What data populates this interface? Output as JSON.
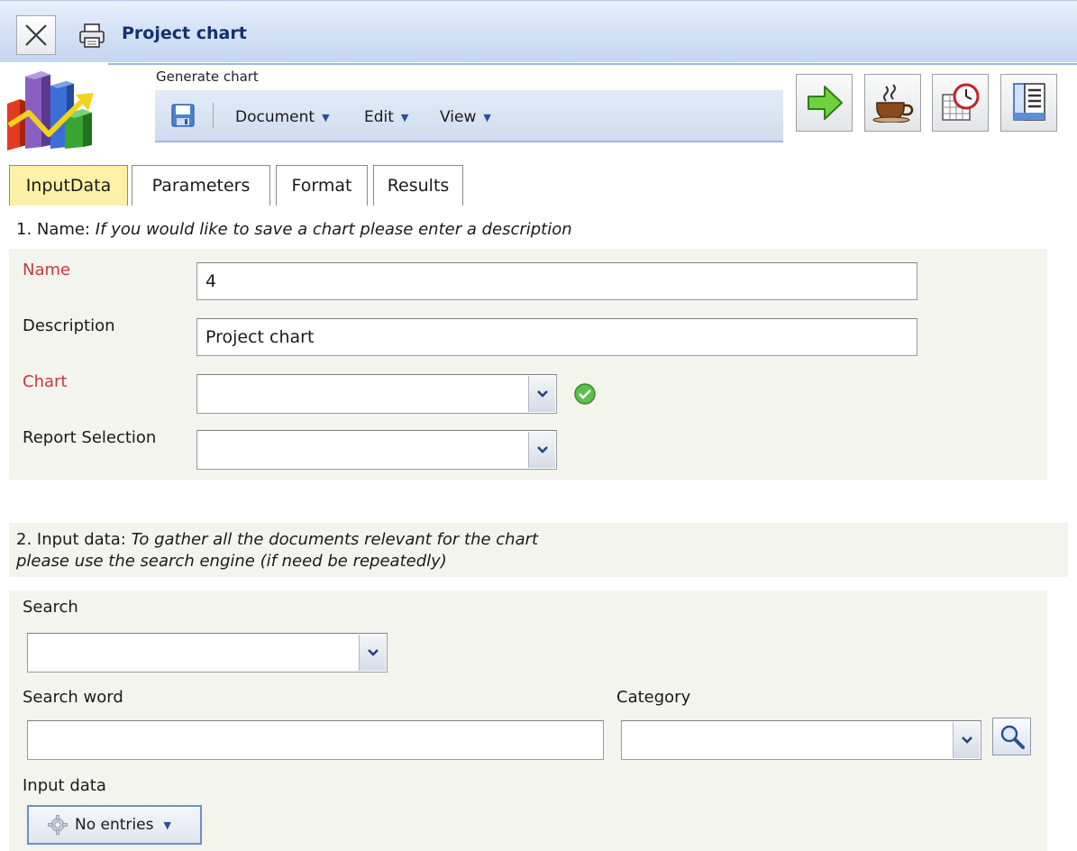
{
  "window": {
    "title": "Project chart",
    "close_icon": "close-icon",
    "print_icon": "printer-icon"
  },
  "toolbar": {
    "label": "Generate chart",
    "save_icon": "save-icon",
    "menus": [
      {
        "label": "Document"
      },
      {
        "label": "Edit"
      },
      {
        "label": "View"
      }
    ],
    "actions": [
      {
        "icon": "green-arrow-right-icon"
      },
      {
        "icon": "coffee-cup-icon"
      },
      {
        "icon": "calendar-clock-icon"
      },
      {
        "icon": "report-list-icon"
      }
    ]
  },
  "tabs": [
    {
      "label": "InputData",
      "active": true
    },
    {
      "label": "Parameters",
      "active": false
    },
    {
      "label": "Format",
      "active": false
    },
    {
      "label": "Results",
      "active": false
    }
  ],
  "section1": {
    "prefix": "1. Name: ",
    "hint": "If you would like to save a chart please enter a description",
    "fields": {
      "name_label": "Name",
      "name_value": "4",
      "description_label": "Description",
      "description_value": "Project chart",
      "chart_label": "Chart",
      "chart_value": "",
      "report_label": "Report Selection",
      "report_value": ""
    }
  },
  "section2": {
    "prefix": "2. Input data: ",
    "hint_line1": "To gather all the documents relevant for the chart",
    "hint_line2": "please use the search engine (if need be repeatedly)",
    "search_label": "Search",
    "search_value": "",
    "search_word_label": "Search word",
    "search_word_value": "",
    "category_label": "Category",
    "category_value": "",
    "input_data_label": "Input data",
    "input_data_button": "No entries"
  },
  "colors": {
    "required_label": "#c23a3a",
    "active_tab": "#fff0a8",
    "title_text": "#14306f",
    "panel_bg": "#f4f4ef"
  }
}
